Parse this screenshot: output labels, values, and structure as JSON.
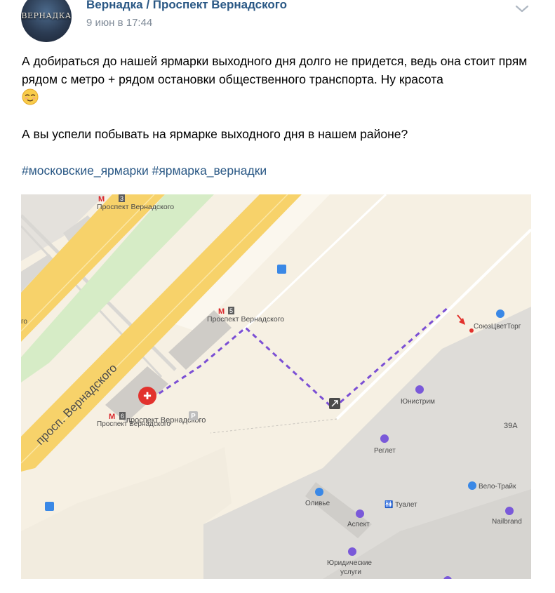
{
  "header": {
    "author": "Вернадка / Проспект Вернадского",
    "date": "9 июн в 17:44",
    "avatar_text": "ВЕРНАДКА"
  },
  "post": {
    "paragraph_1": "А добираться до нашей ярмарки выходного дня долго не придется, ведь она стоит прям рядом с метро + рядом остановки общественного транспорта. Ну красота",
    "paragraph_2": "А вы успели побывать на ярмарке выходного дня в нашем районе?",
    "hashtags": [
      "#московские_ярмарки",
      "#ярмарка_вернадки"
    ]
  },
  "map": {
    "street": "просп. Вернадского",
    "metro_top_line": "3",
    "metro_top_name": "Проспект Вернадского",
    "metro_mid_line": "5",
    "metro_mid_name": "Проспект Вернадского",
    "metro_bottom_line": "6",
    "metro_bottom_name": "Проспект Вернадского",
    "metro_left_partial": "го",
    "exit_label": "проспект Вернадского",
    "parking_label": "P",
    "destination": "СоюзЦветТорг",
    "places": {
      "unistream": "Юнистрим",
      "reglet": "Реглет",
      "velo": "Вело-Трайк",
      "olive": "Оливье",
      "aspect": "Аспект",
      "toilet": "Туалет",
      "nailbrand": "Nailbrand",
      "legal_line1": "Юридические",
      "legal_line2": "услуги"
    },
    "building_number": "39А",
    "colors": {
      "background": "#f6f0e3",
      "road_yellow": "#f7d26a",
      "route": "#7b4fd4",
      "metro_red": "#d9262b",
      "link": "#2a5885",
      "poi_purple": "#7a59d9",
      "poi_blue": "#3a88e6"
    }
  }
}
